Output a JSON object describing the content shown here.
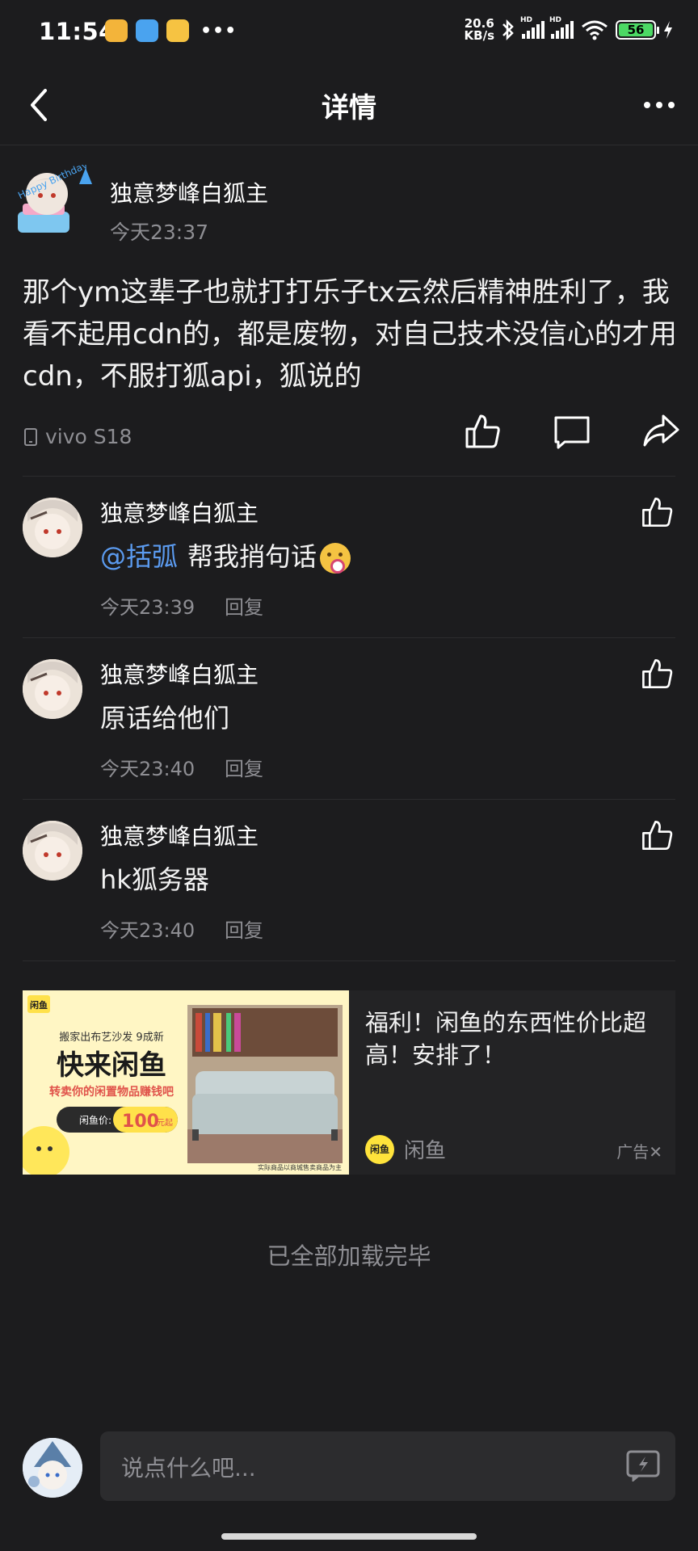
{
  "status": {
    "time": "11:54",
    "net_speed_value": "20.6",
    "net_speed_unit": "KB/s",
    "battery": "56",
    "hd_label": "HD"
  },
  "nav": {
    "title": "详情"
  },
  "post": {
    "author": "独意梦峰白狐主",
    "time": "今天23:37",
    "body": "那个ym这辈子也就打打乐子tx云然后精神胜利了，我看不起用cdn的，都是废物，对自己技术没信心的才用cdn，不服打狐api，狐说的",
    "device": "vivo S18"
  },
  "comments": [
    {
      "author": "独意梦峰白狐主",
      "mention": "@括弧",
      "text": "帮我捎句话",
      "time": "今天23:39",
      "reply": "回复"
    },
    {
      "author": "独意梦峰白狐主",
      "mention": "",
      "text": "原话给他们",
      "time": "今天23:40",
      "reply": "回复"
    },
    {
      "author": "独意梦峰白狐主",
      "mention": "",
      "text": "hk狐务器",
      "time": "今天23:40",
      "reply": "回复"
    }
  ],
  "ad": {
    "text": "福利！闲鱼的东西性价比超高！安排了！",
    "brand": "闲鱼",
    "tag": "广告✕",
    "image_logo": "闲鱼",
    "image_line1": "搬家出布艺沙发 9成新",
    "image_headline": "快来闲鱼",
    "image_subline": "转卖你的闲置物品赚钱吧",
    "price_label": "闲鱼价:",
    "price_value": "100",
    "price_unit": "元起",
    "disclaimer": "实际商品以商城售卖商品为主"
  },
  "end_text": "已全部加载完毕",
  "input": {
    "placeholder": "说点什么吧..."
  }
}
